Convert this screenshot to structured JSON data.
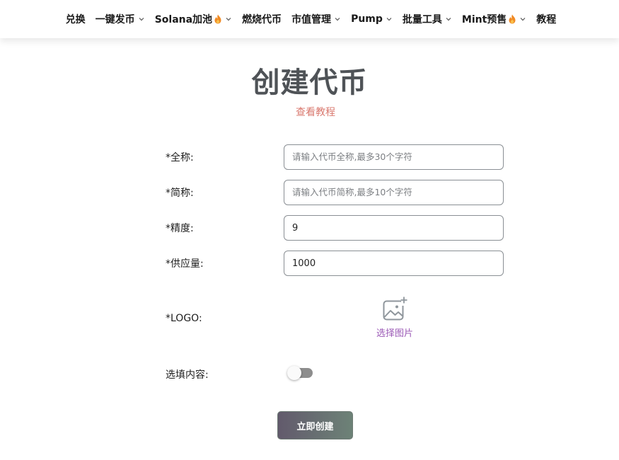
{
  "nav": {
    "items": [
      {
        "label": "兑换",
        "caret": false,
        "flame": false
      },
      {
        "label": "一键发币",
        "caret": true,
        "flame": false
      },
      {
        "label": "Solana加池",
        "caret": true,
        "flame": true
      },
      {
        "label": "燃烧代币",
        "caret": false,
        "flame": false
      },
      {
        "label": "市值管理",
        "caret": true,
        "flame": false
      },
      {
        "label": "Pump",
        "caret": true,
        "flame": false
      },
      {
        "label": "批量工具",
        "caret": true,
        "flame": false
      },
      {
        "label": "Mint预售",
        "caret": true,
        "flame": true
      },
      {
        "label": "教程",
        "caret": false,
        "flame": false
      }
    ],
    "icons": {
      "caret": "chevron-down-icon",
      "flame": "fire-icon"
    },
    "flame_color": "#f08a24"
  },
  "page": {
    "title": "创建代币",
    "tutorial_link": "查看教程"
  },
  "form": {
    "fullname": {
      "label": "*全称:",
      "placeholder": "请输入代币全称,最多30个字符",
      "value": ""
    },
    "symbol": {
      "label": "*简称:",
      "placeholder": "请输入代币简称,最多10个字符",
      "value": ""
    },
    "decimals": {
      "label": "*精度:",
      "placeholder": "",
      "value": "9"
    },
    "supply": {
      "label": "*供应量:",
      "placeholder": "",
      "value": "1000"
    },
    "logo": {
      "label": "*LOGO:",
      "upload_label": "选择图片",
      "icon": "image-add-icon"
    },
    "optional": {
      "label": "选填内容:",
      "enabled": false
    },
    "submit_label": "立即创建"
  },
  "colors": {
    "title": "#4f5357",
    "link": "#d9786e",
    "upload_text": "#9b59b6",
    "button_gradient_start": "#625a6c",
    "button_gradient_end": "#6d8277"
  }
}
